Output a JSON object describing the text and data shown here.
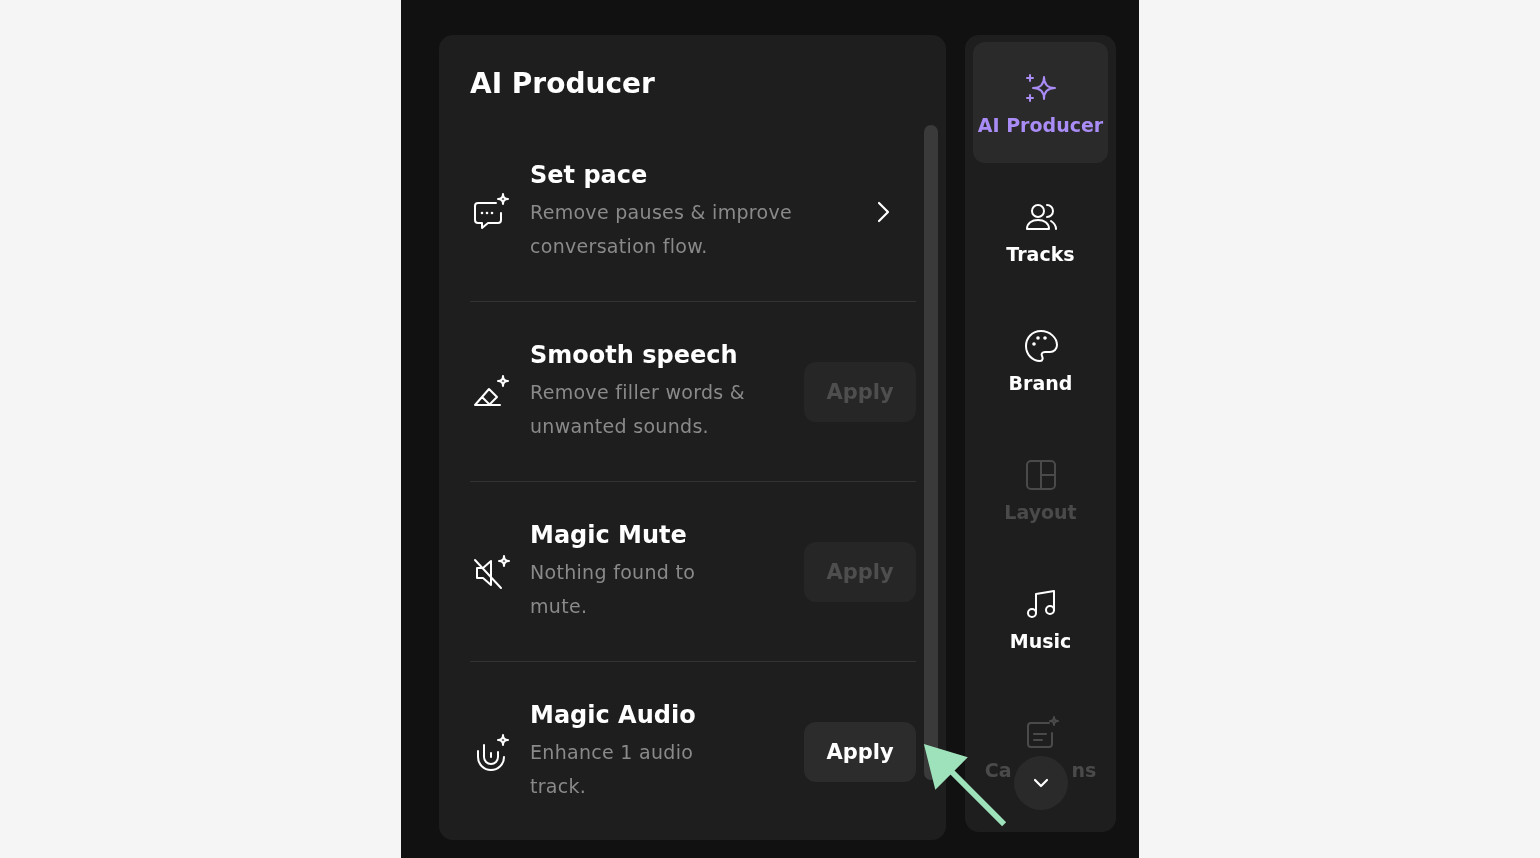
{
  "panel": {
    "title": "AI Producer"
  },
  "tools": [
    {
      "kind": "link",
      "title": "Set pace",
      "description": "Remove pauses & improve conversation flow."
    },
    {
      "kind": "apply",
      "title": "Smooth speech",
      "description": "Remove filler words & unwanted sounds.",
      "button": "Apply",
      "disabled": true
    },
    {
      "kind": "apply",
      "title": "Magic Mute",
      "description": "Nothing found to mute.",
      "button": "Apply",
      "disabled": true
    },
    {
      "kind": "apply",
      "title": "Magic Audio",
      "description": "Enhance 1 audio track.",
      "button": "Apply",
      "disabled": false
    }
  ],
  "sidebar": {
    "items": [
      {
        "label": "AI Producer",
        "selected": true,
        "disabled": false
      },
      {
        "label": "Tracks",
        "selected": false,
        "disabled": false
      },
      {
        "label": "Brand",
        "selected": false,
        "disabled": false
      },
      {
        "label": "Layout",
        "selected": false,
        "disabled": true
      },
      {
        "label": "Music",
        "selected": false,
        "disabled": false
      },
      {
        "label_parts": [
          "Ca",
          "ns"
        ],
        "selected": false,
        "disabled": true
      }
    ]
  }
}
